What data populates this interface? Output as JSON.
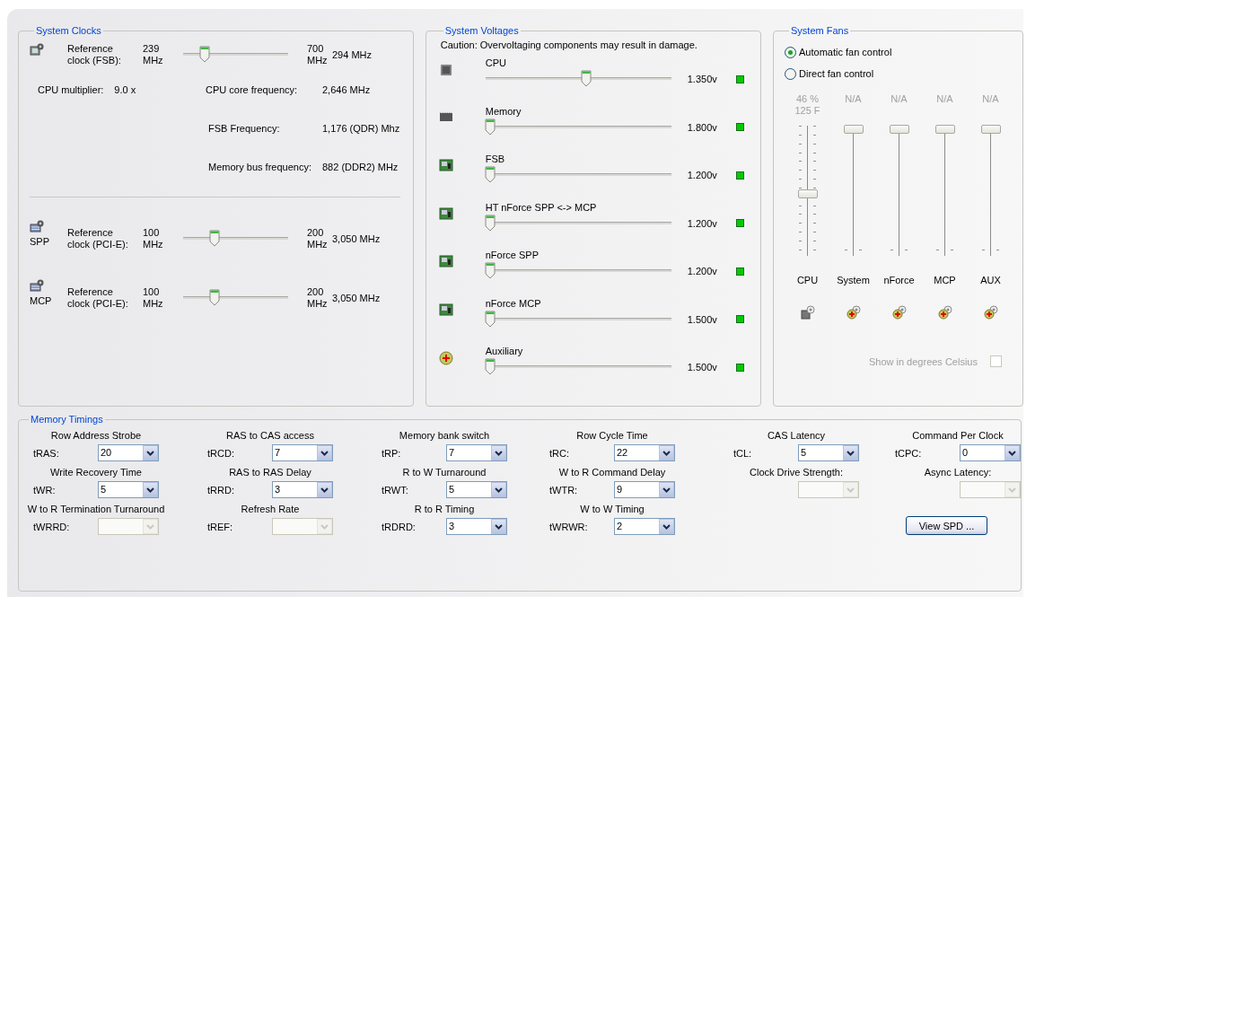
{
  "system_clocks": {
    "title": "System Clocks",
    "main_clock": {
      "label": "Reference clock (FSB):",
      "min": "239 MHz",
      "max": "700 MHz",
      "level": 0.15,
      "reading": "294 MHz"
    },
    "cpu_multiplier": {
      "label": "CPU multiplier:",
      "value": "9.0 x"
    },
    "info": [
      {
        "label": "CPU core frequency:",
        "value": "2,646 MHz"
      },
      {
        "label": "FSB Frequency:",
        "value": "1,176 (QDR) Mhz"
      },
      {
        "label": "Memory bus frequency:",
        "value": "882 (DDR2) MHz"
      }
    ],
    "bus_clocks": [
      {
        "chip": "SPP",
        "label": "Reference clock (PCI-E):",
        "min": "100 MHz",
        "max": "200 MHz",
        "level": 0.25,
        "reading": "3,050 MHz"
      },
      {
        "chip": "MCP",
        "label": "Reference clock (PCI-E):",
        "min": "100 MHz",
        "max": "200 MHz",
        "level": 0.25,
        "reading": "3,050 MHz"
      }
    ]
  },
  "system_voltages": {
    "title": "System Voltages",
    "caution": "Caution: Overvoltaging components may result in damage.",
    "rails": [
      {
        "kind": "cpu",
        "name": "CPU",
        "level": 0.52,
        "reading": "1.350v",
        "color": "#00cc00"
      },
      {
        "kind": "memory",
        "name": "Memory",
        "level": 0,
        "reading": "1.800v",
        "color": "#00cc00"
      },
      {
        "kind": "board",
        "name": "FSB",
        "level": 0,
        "reading": "1.200v",
        "color": "#00cc00"
      },
      {
        "kind": "board",
        "name": "HT nForce SPP <-> MCP",
        "level": 0,
        "reading": "1.200v",
        "color": "#00cc00"
      },
      {
        "kind": "board",
        "name": "nForce SPP",
        "level": 0,
        "reading": "1.200v",
        "color": "#00cc00"
      },
      {
        "kind": "board",
        "name": "nForce MCP",
        "level": 0,
        "reading": "1.500v",
        "color": "#00cc00"
      },
      {
        "kind": "aux",
        "name": "Auxiliary",
        "level": 0,
        "reading": "1.500v",
        "color": "#00cc00"
      }
    ]
  },
  "system_fans": {
    "title": "System Fans",
    "modes": [
      {
        "label": "Automatic fan control",
        "selected": true
      },
      {
        "label": "Direct fan control",
        "selected": false
      }
    ],
    "fans": [
      {
        "kind": "cpu",
        "name": "CPU",
        "readings": [
          "46 %",
          "125 F"
        ],
        "level": 0.47
      },
      {
        "kind": "plus",
        "name": "System",
        "readings": [
          "N/A"
        ],
        "level": 1
      },
      {
        "kind": "plus",
        "name": "nForce",
        "readings": [
          "N/A"
        ],
        "level": 1
      },
      {
        "kind": "plus",
        "name": "MCP",
        "readings": [
          "N/A"
        ],
        "level": 1
      },
      {
        "kind": "plus",
        "name": "AUX",
        "readings": [
          "N/A"
        ],
        "level": 1
      }
    ],
    "celsius": {
      "label": "Show in degrees Celsius",
      "checked": false,
      "disabled": true
    }
  },
  "memory_timings": {
    "title": "Memory Timings",
    "items": [
      {
        "title": "Row Address Strobe",
        "label": "tRAS:",
        "value": "20",
        "disabled": false
      },
      {
        "title": "RAS to CAS access",
        "label": "tRCD:",
        "value": "7",
        "disabled": false
      },
      {
        "title": "Memory bank switch",
        "label": "tRP:",
        "value": "7",
        "disabled": false
      },
      {
        "title": "Row Cycle Time",
        "label": "tRC:",
        "value": "22",
        "disabled": false
      },
      {
        "title": "CAS Latency",
        "label": "tCL:",
        "value": "5",
        "disabled": false
      },
      {
        "title": "Command Per Clock",
        "label": "tCPC:",
        "value": "0",
        "disabled": false
      },
      {
        "title": "Write Recovery Time",
        "label": "tWR:",
        "value": "5",
        "disabled": false
      },
      {
        "title": "RAS to RAS Delay",
        "label": "tRRD:",
        "value": "3",
        "disabled": false
      },
      {
        "title": "R to W Turnaround",
        "label": "tRWT:",
        "value": "5",
        "disabled": false
      },
      {
        "title": "W to R Command Delay",
        "label": "tWTR:",
        "value": "9",
        "disabled": false
      },
      {
        "title": "Clock Drive Strength:",
        "disabled": true
      },
      {
        "title": "Async Latency:",
        "disabled": true
      },
      {
        "title": "W to R Termination Turnaround",
        "label": "tWRRD:",
        "disabled": true
      },
      {
        "title": "Refresh Rate",
        "label": "tREF:",
        "disabled": true
      },
      {
        "title": "R to R Timing",
        "label": "tRDRD:",
        "value": "3",
        "disabled": false
      },
      {
        "title": "W to W Timing",
        "label": "tWRWR:",
        "value": "2",
        "disabled": false
      }
    ],
    "button": "View SPD ..."
  }
}
